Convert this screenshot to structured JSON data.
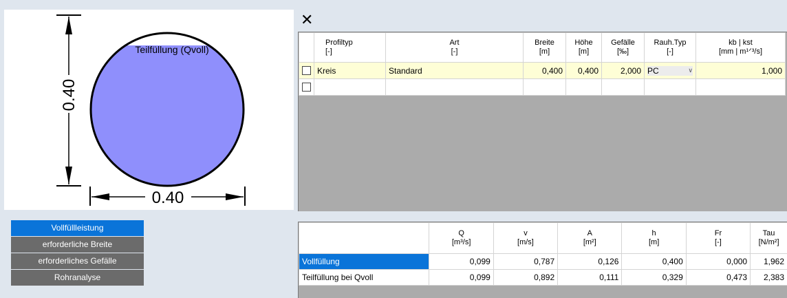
{
  "drawing": {
    "fill_label": "Teilfüllung (Qvoll)",
    "dim_vertical": "0.40",
    "dim_horizontal": "0.40",
    "fill_color": "#8f8ffc"
  },
  "close_label": "✕",
  "profile_table": {
    "headers": [
      {
        "line1": "Profiltyp",
        "line2": "[-]"
      },
      {
        "line1": "Art",
        "line2": "[-]"
      },
      {
        "line1": "Breite",
        "line2": "[m]"
      },
      {
        "line1": "Höhe",
        "line2": "[m]"
      },
      {
        "line1": "Gefälle",
        "line2": "[‰]"
      },
      {
        "line1": "Rauh.Typ",
        "line2": "[-]"
      },
      {
        "line1": "kb | kst",
        "line2": "[mm | m¹ᐟ³/s]"
      }
    ],
    "rows": [
      {
        "profiltyp": "Kreis",
        "art": "Standard",
        "breite": "0,400",
        "hoehe": "0,400",
        "gefaelle": "2,000",
        "rauh_typ": "PC",
        "kb_kst": "1,000"
      }
    ]
  },
  "nav": {
    "items": [
      "Vollfüllleistung",
      "erforderliche Breite",
      "erforderliches Gefälle",
      "Rohranalyse"
    ],
    "active_index": 0
  },
  "results_table": {
    "headers": [
      {
        "line1": "Q",
        "line2": "[m³/s]"
      },
      {
        "line1": "v",
        "line2": "[m/s]"
      },
      {
        "line1": "A",
        "line2": "[m²]"
      },
      {
        "line1": "h",
        "line2": "[m]"
      },
      {
        "line1": "Fr",
        "line2": "[-]"
      },
      {
        "line1": "Tau",
        "line2": "[N/m²]"
      }
    ],
    "rows": [
      {
        "label": "Vollfüllung",
        "values": [
          "0,099",
          "0,787",
          "0,126",
          "0,400",
          "0,000",
          "1,962"
        ]
      },
      {
        "label": "Teilfüllung bei Qvoll",
        "values": [
          "0,099",
          "0,892",
          "0,111",
          "0,329",
          "0,473",
          "2,383"
        ]
      }
    ]
  }
}
